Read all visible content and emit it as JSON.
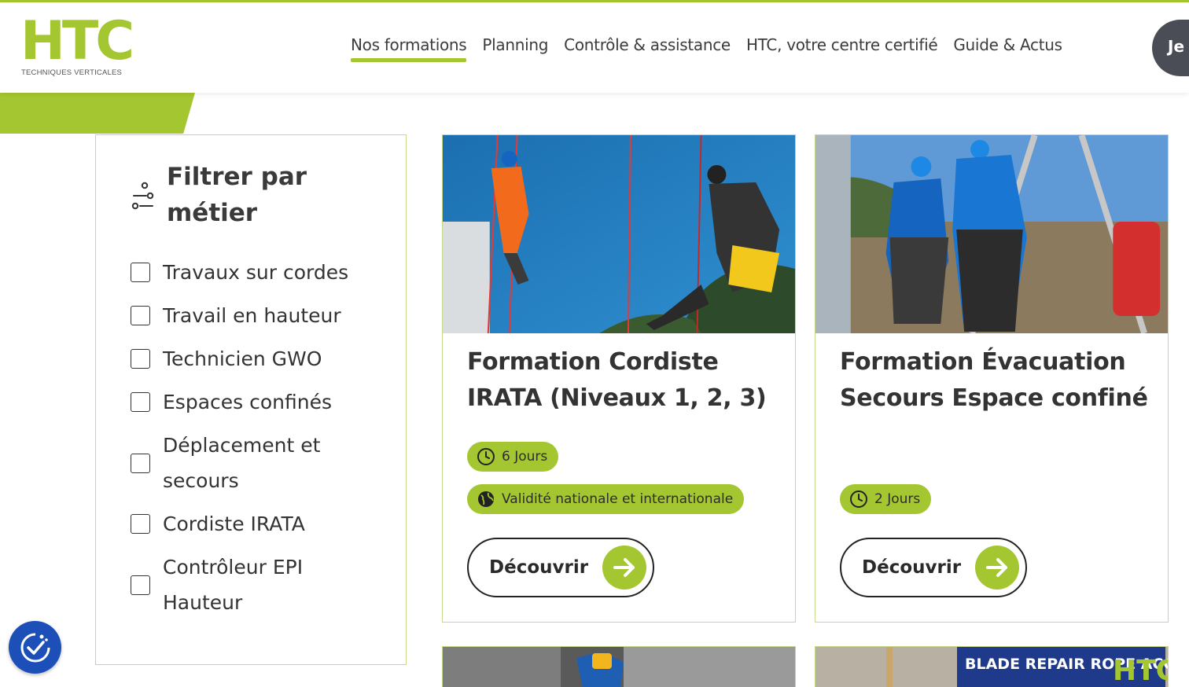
{
  "brand": {
    "logo_letters": "HTC",
    "logo_tagline": "TECHNIQUES VERTICALES",
    "accent_color": "#a4c630",
    "dark_color": "#4a4d55"
  },
  "nav": {
    "items": [
      "Nos formations",
      "Planning",
      "Contrôle & assistance",
      "HTC, votre centre certifié",
      "Guide & Actus"
    ],
    "active": "Nos formations",
    "cta_label": "Je"
  },
  "filter": {
    "title": "Filtrer par métier",
    "icon": "sliders-icon",
    "options": [
      "Travaux sur cordes",
      "Travail en hauteur",
      "Technicien GWO",
      "Espaces confinés",
      "Déplacement et secours",
      "Cordiste IRATA",
      "Contrôleur EPI Hauteur"
    ]
  },
  "cards": [
    {
      "title": "Formation Cordiste IRATA (Niveaux 1, 2, 3)",
      "duration": "6 Jours",
      "validity": "Validité nationale et internationale",
      "button_label": "Découvrir"
    },
    {
      "title": "Formation Évacuation Secours Espace confiné",
      "duration": "2 Jours",
      "button_label": "Découvrir"
    }
  ],
  "bottom_cards": [
    {
      "image_text": ""
    },
    {
      "image_text": "BLADE REPAIR ROPE ACCESS"
    }
  ],
  "accessibility": {
    "icon": "accessibility-icon"
  }
}
